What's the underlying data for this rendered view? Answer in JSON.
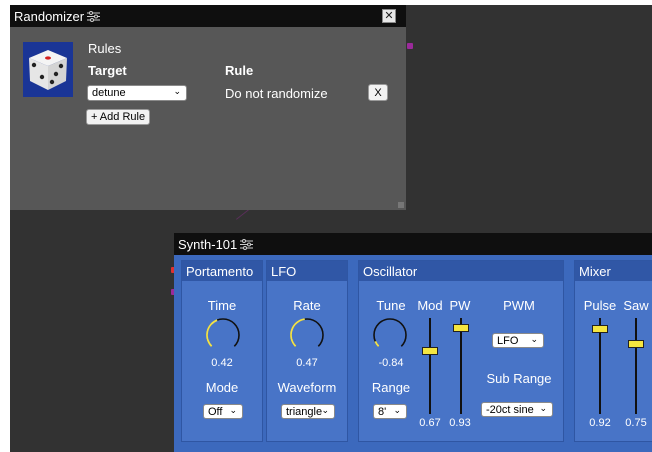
{
  "randomizer": {
    "title": "Randomizer",
    "close_label": "✕",
    "rules_heading": "Rules",
    "target_header": "Target",
    "rule_header": "Rule",
    "rule_row": {
      "target": "detune",
      "rule": "Do not randomize",
      "remove_label": "X"
    },
    "add_rule_label": "+ Add Rule"
  },
  "synth": {
    "title": "Synth-101",
    "sections": {
      "portamento": {
        "title": "Portamento",
        "time_label": "Time",
        "time_value": "0.42",
        "time_level": 0.42,
        "mode_label": "Mode",
        "mode_value": "Off"
      },
      "lfo": {
        "title": "LFO",
        "rate_label": "Rate",
        "rate_value": "0.47",
        "rate_level": 0.47,
        "waveform_label": "Waveform",
        "waveform_value": "triangle"
      },
      "oscillator": {
        "title": "Oscillator",
        "tune_label": "Tune",
        "tune_value": "-0.84",
        "tune_level": 0.08,
        "range_label": "Range",
        "range_value": "8'",
        "mod_label": "Mod",
        "mod_value": "0.67",
        "mod_level": 0.67,
        "pw_label": "PW",
        "pw_value": "0.93",
        "pw_level": 0.93,
        "pwm_label": "PWM",
        "pwm_value": "LFO",
        "sub_range_label": "Sub Range",
        "sub_range_value": "-20ct sine"
      },
      "mixer": {
        "title": "Mixer",
        "pulse_label": "Pulse",
        "pulse_value": "0.92",
        "pulse_level": 0.92,
        "saw_label": "Saw",
        "saw_value": "0.75",
        "saw_level": 0.75
      }
    }
  },
  "colors": {
    "canvas": "#323232",
    "synth_body": "#3c69bd",
    "knob_arc": "#f2e24a",
    "slider_thumb": "#f5e640",
    "port_red": "#e03030",
    "port_purple": "#9b2a9b"
  }
}
